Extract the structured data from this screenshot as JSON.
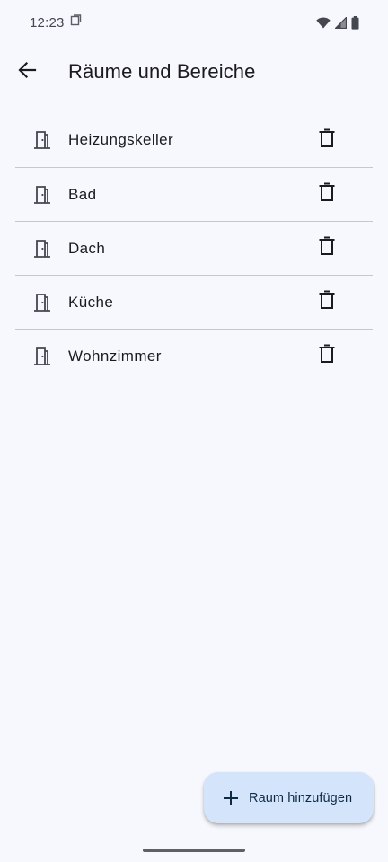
{
  "status_bar": {
    "time": "12:23",
    "icons": [
      "screenshot-notification-icon",
      "wifi-icon",
      "cell-signal-icon",
      "battery-icon"
    ]
  },
  "app_bar": {
    "back_icon": "arrow-back-icon",
    "title": "Räume und Bereiche"
  },
  "rooms": [
    {
      "name": "Heizungskeller"
    },
    {
      "name": "Bad"
    },
    {
      "name": "Dach"
    },
    {
      "name": "Küche"
    },
    {
      "name": "Wohnzimmer"
    }
  ],
  "room_icon": "door-icon",
  "delete_icon": "trash-icon",
  "fab": {
    "icon": "plus-icon",
    "label": "Raum hinzufügen"
  },
  "colors": {
    "background": "#f7f8fd",
    "fab_background": "#d3e4fb",
    "text": "#1b1b1f",
    "divider": "#c8c8cc"
  }
}
